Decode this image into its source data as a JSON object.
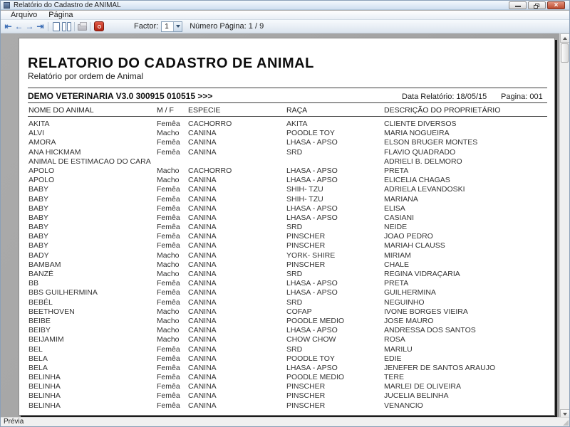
{
  "window": {
    "title": "Relatório do Cadastro de ANIMAL",
    "status": "Prévia",
    "close_glyph": "×"
  },
  "menu": {
    "items": [
      {
        "label": "Arquivo"
      },
      {
        "label": "Página"
      }
    ]
  },
  "toolbar": {
    "icons": {
      "first_page": "⇤",
      "prev_page": "←",
      "next_page": "→",
      "last_page": "⇥"
    },
    "factor_label": "Factor:",
    "factor_value": "1",
    "page_number_label": "Número Página: 1 / 9"
  },
  "colors": {
    "arrow_blue": "#3d6eb5",
    "exit_red": "#b02414",
    "workspace_gray": "#a6a6a6"
  },
  "report": {
    "title": "RELATORIO DO CADASTRO DE ANIMAL",
    "subtitle": "Relatório por ordem de Animal",
    "vendor_line": "DEMO VETERINARIA V3.0 300915 010515 >>>",
    "date_label": "Data Relatório: 18/05/15",
    "page_label": "Pagina: 001",
    "columns": [
      "NOME DO ANIMAL",
      "M / F",
      "ESPECIE",
      "RAÇA",
      "DESCRIÇÃO DO PROPRIETÁRIO"
    ],
    "rows": [
      [
        "AKITA",
        "Femêa",
        "CACHORRO",
        "AKITA",
        "CLIENTE DIVERSOS"
      ],
      [
        "ALVI",
        "Macho",
        "CANINA",
        "POODLE TOY",
        "MARIA NOGUEIRA"
      ],
      [
        "AMORA",
        "Femêa",
        "CANINA",
        "LHASA - APSO",
        "ELSON BRUGER MONTES"
      ],
      [
        "ANA HICKMAM",
        "Femêa",
        "CANINA",
        "SRD",
        "FLAVIO QUADRADO"
      ],
      [
        "ANIMAL DE ESTIMACAO DO CARA",
        "",
        "",
        "",
        "ADRIELI B. DELMORO"
      ],
      [
        "APOLO",
        "Macho",
        "CACHORRO",
        "LHASA - APSO",
        "PRETA"
      ],
      [
        "APOLO",
        "Macho",
        "CANINA",
        "LHASA - APSO",
        "ELICELIA CHAGAS"
      ],
      [
        "BABY",
        "Femêa",
        "CANINA",
        "SHIH- TZU",
        "ADRIELA LEVANDOSKI"
      ],
      [
        "BABY",
        "Femêa",
        "CANINA",
        "SHIH- TZU",
        "MARIANA"
      ],
      [
        "BABY",
        "Femêa",
        "CANINA",
        "LHASA - APSO",
        "ELISA"
      ],
      [
        "BABY",
        "Femêa",
        "CANINA",
        "LHASA - APSO",
        "CASIANI"
      ],
      [
        "BABY",
        "Femêa",
        "CANINA",
        "SRD",
        "NEIDE"
      ],
      [
        "BABY",
        "Femêa",
        "CANINA",
        "PINSCHER",
        "JOAO PEDRO"
      ],
      [
        "BABY",
        "Femêa",
        "CANINA",
        "PINSCHER",
        "MARIAH CLAUSS"
      ],
      [
        "BADY",
        "Macho",
        "CANINA",
        "YORK- SHIRE",
        "MIRIAM"
      ],
      [
        "BAMBAM",
        "Macho",
        "CANINA",
        "PINSCHER",
        "CHALE"
      ],
      [
        "BANZÉ",
        "Macho",
        "CANINA",
        "SRD",
        "REGINA VIDRAÇARIA"
      ],
      [
        "BB",
        "Femêa",
        "CANINA",
        "LHASA - APSO",
        "PRETA"
      ],
      [
        "BBS GUILHERMINA",
        "Femêa",
        "CANINA",
        "LHASA - APSO",
        "GUILHERMINA"
      ],
      [
        "BEBÉL",
        "Femêa",
        "CANINA",
        "SRD",
        "NEGUINHO"
      ],
      [
        "BEETHOVEN",
        "Macho",
        "CANINA",
        "COFAP",
        "IVONE BORGES VIEIRA"
      ],
      [
        "BEIBE",
        "Macho",
        "CANINA",
        "POODLE MEDIO",
        "JOSE MAURO"
      ],
      [
        "BEIBY",
        "Macho",
        "CANINA",
        "LHASA - APSO",
        "ANDRESSA DOS SANTOS"
      ],
      [
        "BEIJAMIM",
        "Macho",
        "CANINA",
        "CHOW CHOW",
        "ROSA"
      ],
      [
        "BEL",
        "Femêa",
        "CANINA",
        "SRD",
        "MARILU"
      ],
      [
        "BELA",
        "Femêa",
        "CANINA",
        "POODLE TOY",
        "EDIE"
      ],
      [
        "BELA",
        "Femêa",
        "CANINA",
        "LHASA - APSO",
        "JENEFER DE SANTOS ARAUJO"
      ],
      [
        "BELINHA",
        "Femêa",
        "CANINA",
        "POODLE MEDIO",
        "TERE"
      ],
      [
        "BELINHA",
        "Femêa",
        "CANINA",
        "PINSCHER",
        "MARLEI DE OLIVEIRA"
      ],
      [
        "BELINHA",
        "Femêa",
        "CANINA",
        "PINSCHER",
        "JUCELIA BELINHA"
      ],
      [
        "BELINHA",
        "Femêa",
        "CANINA",
        "PINSCHER",
        "VENANCIO"
      ]
    ]
  }
}
